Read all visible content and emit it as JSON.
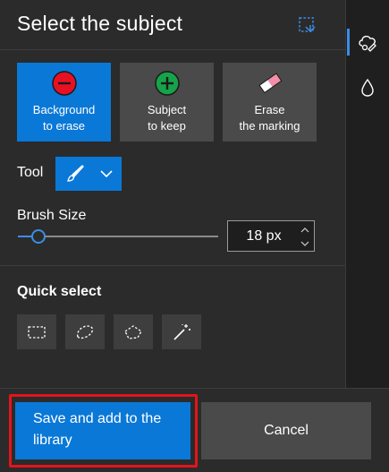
{
  "panel": {
    "title": "Select the subject"
  },
  "modes": [
    {
      "label": "Background\nto erase",
      "icon": "minus-circle-icon",
      "selected": true
    },
    {
      "label": "Subject\nto keep",
      "icon": "plus-circle-icon",
      "selected": false
    },
    {
      "label": "Erase\nthe marking",
      "icon": "eraser-icon",
      "selected": false
    }
  ],
  "tool": {
    "label": "Tool",
    "selected_icon": "brush-icon"
  },
  "brush": {
    "label": "Brush Size",
    "value": "18 px",
    "slider_fraction": 0.07
  },
  "quick_select": {
    "label": "Quick select",
    "tools": [
      "rectangle-select-icon",
      "lasso-select-icon",
      "polygon-select-icon",
      "magic-wand-icon"
    ]
  },
  "footer": {
    "save_label": "Save and add to the library",
    "cancel_label": "Cancel"
  },
  "colors": {
    "accent": "#0a78d7",
    "highlight_outline": "#e3141b",
    "background": "#2b2b2b",
    "button": "#4a4a4a"
  }
}
